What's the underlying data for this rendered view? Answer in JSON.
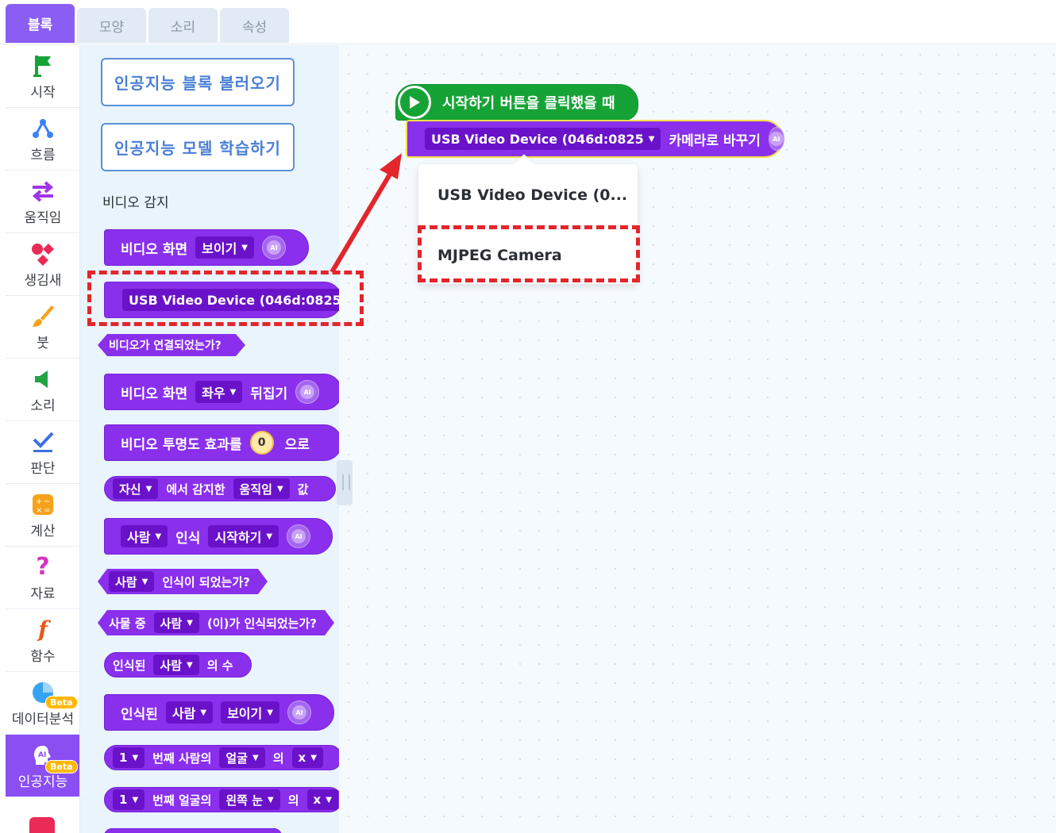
{
  "tabs": [
    "블록",
    "모양",
    "소리",
    "속성"
  ],
  "categories": [
    {
      "label": "시작",
      "icon": "flag-icon"
    },
    {
      "label": "흐름",
      "icon": "flow-icon"
    },
    {
      "label": "움직임",
      "icon": "arrows-icon"
    },
    {
      "label": "생김새",
      "icon": "shapes-icon"
    },
    {
      "label": "붓",
      "icon": "brush-icon"
    },
    {
      "label": "소리",
      "icon": "speaker-icon"
    },
    {
      "label": "판단",
      "icon": "check-icon"
    },
    {
      "label": "계산",
      "icon": "calculator-icon"
    },
    {
      "label": "자료",
      "icon": "question-icon"
    },
    {
      "label": "함수",
      "icon": "function-icon"
    },
    {
      "label": "데이터분석",
      "icon": "pie-chart-icon",
      "badge": "Beta"
    },
    {
      "label": "인공지능",
      "icon": "ai-head-icon",
      "badge": "Beta"
    }
  ],
  "palette": {
    "load_ai_blocks": "인공지능 블록 불러오기",
    "train_ai_model": "인공지능 모델 학습하기",
    "section_title": "비디오 감지",
    "blocks": {
      "b1": {
        "t1": "비디오 화면",
        "d1": "보이기"
      },
      "b2": {
        "d1": "USB Video Device (046d:0825"
      },
      "b3": {
        "t1": "비디오가 연결되었는가?"
      },
      "b4": {
        "t1": "비디오 화면",
        "d1": "좌우",
        "t2": "뒤집기"
      },
      "b5": {
        "t1": "비디오 투명도 효과를",
        "n1": "0",
        "t2": "으로"
      },
      "b6": {
        "d1": "자신",
        "t1": "에서 감지한",
        "d2": "움직임",
        "t2": "값"
      },
      "b7": {
        "d1": "사람",
        "t1": "인식",
        "d2": "시작하기"
      },
      "b8": {
        "d1": "사람",
        "t1": "인식이 되었는가?"
      },
      "b9": {
        "t1": "사물 중",
        "d1": "사람",
        "t2": "(이)가 인식되었는가?"
      },
      "b10": {
        "t1": "인식된",
        "d1": "사람",
        "t2": "의 수"
      },
      "b11": {
        "t1": "인식된",
        "d1": "사람",
        "d2": "보이기"
      },
      "b12": {
        "d1": "1",
        "t1": "번째 사람의",
        "d2": "얼굴",
        "t2": "의",
        "d3": "x"
      },
      "b13": {
        "d1": "1",
        "t1": "번째 얼굴의",
        "d2": "왼쪽 눈",
        "t2": "의",
        "d3": "x"
      }
    },
    "ai_icon_text": "AI"
  },
  "workspace": {
    "start_block": "시작하기 버튼을 클릭했을 때",
    "camera_block": {
      "device": "USB Video Device (046d:0825",
      "label": "카메라로 바꾸기"
    },
    "dropdown_options": [
      "USB Video Device (0...",
      "MJPEG Camera"
    ]
  },
  "colors": {
    "accent": "#8a5ef2",
    "block_purple": "#8a30ec",
    "start_green": "#16a336",
    "annotation_red": "#e3262b"
  }
}
